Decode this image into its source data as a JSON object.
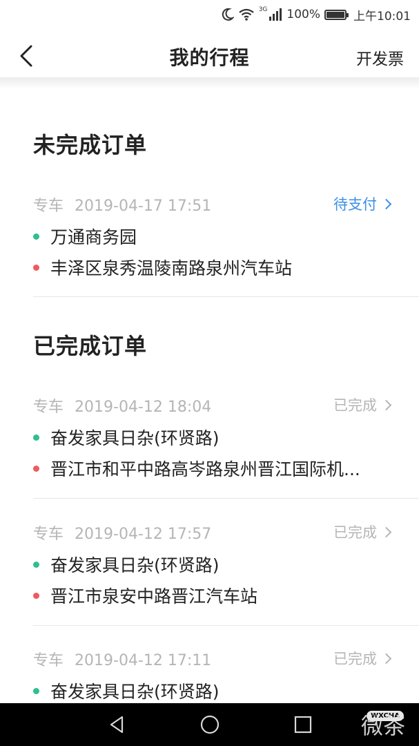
{
  "status_bar": {
    "network": "3G",
    "battery": "100%",
    "time": "上午10:01",
    "icons": [
      "moon-icon",
      "wifi-icon",
      "signal-icon",
      "battery-icon"
    ]
  },
  "navbar": {
    "title": "我的行程",
    "action": "开发票",
    "back_icon": "chevron-left-icon"
  },
  "sections": {
    "pending_title": "未完成订单",
    "completed_title": "已完成订单"
  },
  "pending_orders": [
    {
      "type": "专车",
      "datetime": "2019-04-17 17:51",
      "status": "待支付",
      "from": "万通商务园",
      "to": "丰泽区泉秀温陵南路泉州汽车站"
    }
  ],
  "completed_orders": [
    {
      "type": "专车",
      "datetime": "2019-04-12 18:04",
      "status": "已完成",
      "from": "奋发家具日杂(环贤路)",
      "to": "晋江市和平中路高岑路泉州晋江国际机..."
    },
    {
      "type": "专车",
      "datetime": "2019-04-12 17:57",
      "status": "已完成",
      "from": "奋发家具日杂(环贤路)",
      "to": "晋江市泉安中路晋江汽车站"
    },
    {
      "type": "专车",
      "datetime": "2019-04-12 17:11",
      "status": "已完成",
      "from": "奋发家具日杂(环贤路)"
    }
  ],
  "colors": {
    "pending_status": "#3a8ee6",
    "start_dot": "#2fbf8f",
    "end_dot": "#ef5a5f",
    "muted_text": "#b5b5b5"
  },
  "watermark": {
    "text": "微茶",
    "badge": "WXCHA"
  }
}
